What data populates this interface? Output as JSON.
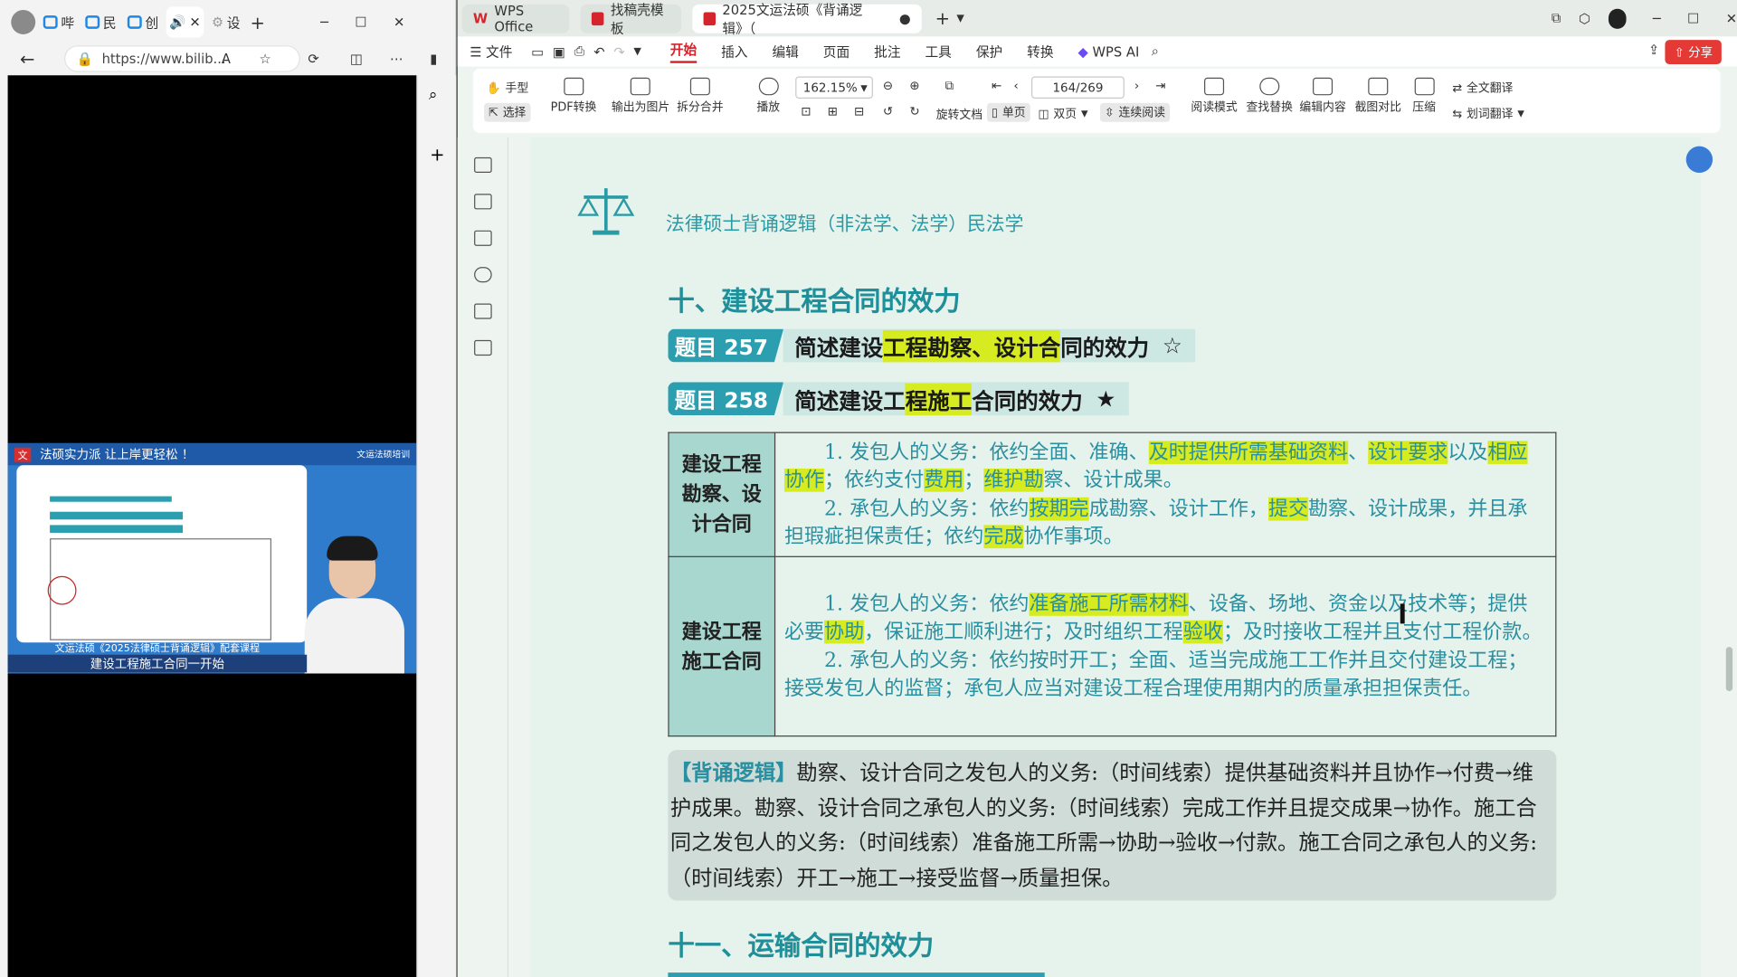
{
  "browser": {
    "tabs": [
      "哔",
      "民",
      "创",
      "设"
    ],
    "url": "https://www.bilib...",
    "video": {
      "header_text": "法硕实力派  让上岸更轻松 ！",
      "brand": "文运法硕培训",
      "caption_small": "文运法硕《2025法律硕士背诵逻辑》配套课程",
      "subtitle": "建设工程施工合同一开始"
    }
  },
  "wps": {
    "tabs": [
      {
        "label": "WPS Office",
        "icon": "wps-logo-icon"
      },
      {
        "label": "找稿壳模板",
        "icon": "template-icon"
      },
      {
        "label": "2025文运法硕《背诵逻辑》（",
        "icon": "pdf-icon"
      }
    ],
    "menu": [
      "文件",
      "开始",
      "插入",
      "编辑",
      "页面",
      "批注",
      "工具",
      "保护",
      "转换",
      "WPS AI"
    ],
    "active_menu": "开始",
    "share_label": "分享",
    "toolbar": {
      "hand": "手型",
      "select": "选择",
      "pdf_convert": "PDF转换",
      "export_image": "输出为图片",
      "split_merge": "拆分合并",
      "play": "播放",
      "zoom": "162.15%",
      "page": "164/269",
      "rotate": "旋转文档",
      "single": "单页",
      "double": "双页",
      "continuous": "连续阅读",
      "reading_mode": "阅读模式",
      "find_replace": "查找替换",
      "edit_content": "编辑内容",
      "screenshot_compare": "截图对比",
      "compress": "压缩",
      "full_translate": "全文翻译",
      "word_translate": "划词翻译"
    }
  },
  "doc": {
    "header": "法律硕士背诵逻辑（非法学、法学）民法学",
    "section1": "十、建设工程合同的效力",
    "q257": {
      "num": "题目 257",
      "pre": "简述建设",
      "hl": "工程勘察、设计合",
      "post": "同的效力",
      "star": "☆"
    },
    "q258": {
      "num": "题目 258",
      "pre": "简述建设工",
      "hl": "程施工",
      "post": "合同的效力",
      "star": "★"
    },
    "row1": {
      "head": "建设工程勘察、设计合同",
      "p1": {
        "a": "1. 发包人的义务：依约全面、准确、",
        "b": "及时提供所需基础资料",
        "c": "、",
        "d": "设计要求",
        "e": "以及",
        "f": "相应协作",
        "g": "；依约支付",
        "h": "费用",
        "i": "；",
        "j": "维护勘",
        "k": "察、设计成果。"
      },
      "p2": {
        "a": "2. 承包人的义务：依约",
        "b": "按期完",
        "c": "成勘察、设计工作，",
        "d": "提交",
        "e": "勘察、设计成果，并且承担瑕疵担保责任；依约",
        "f": "完成",
        "g": "协作事项。"
      }
    },
    "row2": {
      "head": "建设工程施工合同",
      "p1": {
        "a": "1. 发包人的义务：依约",
        "b": "准备施工所需材料",
        "c": "、设备、场地、资金以及技术等；提供必要",
        "d": "协助",
        "e": "，保证施工顺利进行；及时组织工程",
        "f": "验收",
        "g": "；及时接收工程并且支付工程价款。"
      },
      "p2": "2. 承包人的义务：依约按时开工；全面、适当完成施工工作并且交付建设工程；接受发包人的监督；承包人应当对建设工程合理使用期内的质量承担担保责任。"
    },
    "logic_tag": "【背诵逻辑】",
    "logic_text": "勘察、设计合同之发包人的义务:（时间线索）提供基础资料并且协作→付费→维护成果。勘察、设计合同之承包人的义务:（时间线索）完成工作并且提交成果→协作。施工合同之发包人的义务:（时间线索）准备施工所需→协助→验收→付款。施工合同之承包人的义务:（时间线索）开工→施工→接受监督→质量担保。",
    "section2": "十一、运输合同的效力"
  }
}
